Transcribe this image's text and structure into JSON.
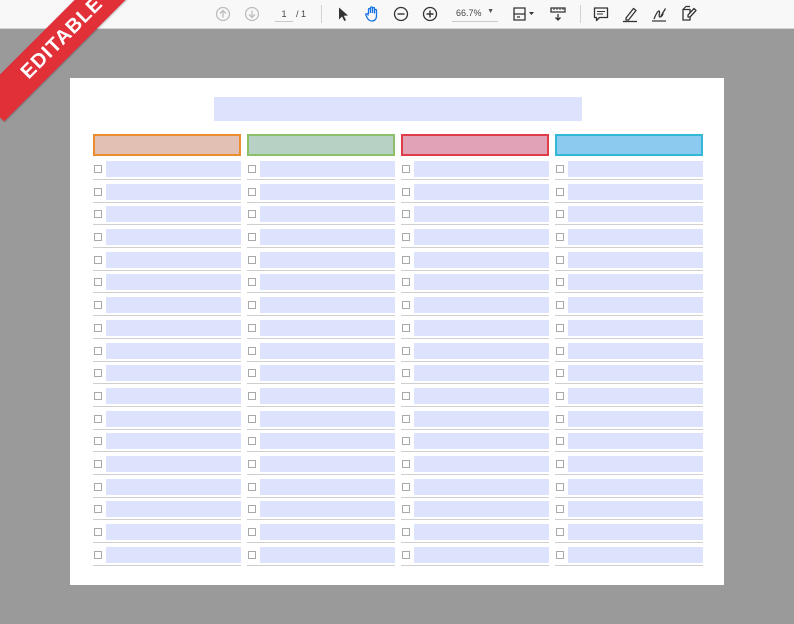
{
  "badge": {
    "label": "EDITABLE",
    "color": "#e23039"
  },
  "toolbar": {
    "page_current": "1",
    "page_total": "/ 1",
    "zoom_value": "66.7%",
    "icons": [
      "arrow-up-circle-icon",
      "arrow-down-circle-icon",
      "pointer-icon",
      "hand-icon",
      "zoom-out-icon",
      "zoom-in-icon",
      "fit-page-icon",
      "scroll-mode-icon",
      "comment-icon",
      "highlight-pen-icon",
      "sign-icon",
      "edit-pdf-icon"
    ],
    "accent_color": "#1473e6"
  },
  "form": {
    "field_color": "#dde3fc",
    "rows_per_column": 18,
    "columns": [
      {
        "header_fill": "#e2c0b3",
        "header_border": "#eb8d2f"
      },
      {
        "header_fill": "#b7d2c4",
        "header_border": "#8ec069"
      },
      {
        "header_fill": "#e1a2b7",
        "header_border": "#df3d4a"
      },
      {
        "header_fill": "#8ccbef",
        "header_border": "#32b7d6"
      }
    ]
  }
}
